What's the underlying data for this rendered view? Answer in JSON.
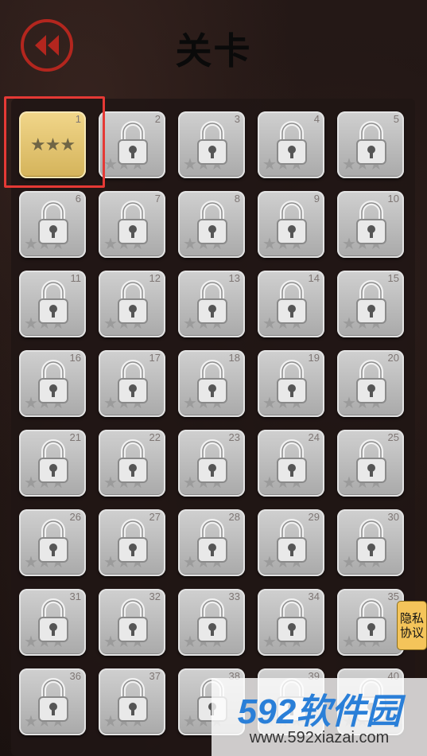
{
  "header": {
    "title": "关卡",
    "back_icon": "rewind-icon",
    "back_color": "#b3261e"
  },
  "levels": [
    {
      "num": "1",
      "locked": false,
      "stars": 3
    },
    {
      "num": "2",
      "locked": true
    },
    {
      "num": "3",
      "locked": true
    },
    {
      "num": "4",
      "locked": true
    },
    {
      "num": "5",
      "locked": true
    },
    {
      "num": "6",
      "locked": true
    },
    {
      "num": "7",
      "locked": true
    },
    {
      "num": "8",
      "locked": true
    },
    {
      "num": "9",
      "locked": true
    },
    {
      "num": "10",
      "locked": true
    },
    {
      "num": "11",
      "locked": true
    },
    {
      "num": "12",
      "locked": true
    },
    {
      "num": "13",
      "locked": true
    },
    {
      "num": "14",
      "locked": true
    },
    {
      "num": "15",
      "locked": true
    },
    {
      "num": "16",
      "locked": true
    },
    {
      "num": "17",
      "locked": true
    },
    {
      "num": "18",
      "locked": true
    },
    {
      "num": "19",
      "locked": true
    },
    {
      "num": "20",
      "locked": true
    },
    {
      "num": "21",
      "locked": true
    },
    {
      "num": "22",
      "locked": true
    },
    {
      "num": "23",
      "locked": true
    },
    {
      "num": "24",
      "locked": true
    },
    {
      "num": "25",
      "locked": true
    },
    {
      "num": "26",
      "locked": true
    },
    {
      "num": "27",
      "locked": true
    },
    {
      "num": "28",
      "locked": true
    },
    {
      "num": "29",
      "locked": true
    },
    {
      "num": "30",
      "locked": true
    },
    {
      "num": "31",
      "locked": true
    },
    {
      "num": "32",
      "locked": true
    },
    {
      "num": "33",
      "locked": true
    },
    {
      "num": "34",
      "locked": true
    },
    {
      "num": "35",
      "locked": true
    },
    {
      "num": "36",
      "locked": true
    },
    {
      "num": "37",
      "locked": true
    },
    {
      "num": "38",
      "locked": true
    },
    {
      "num": "39",
      "locked": true
    },
    {
      "num": "40",
      "locked": true
    }
  ],
  "privacy": {
    "line1": "隐私",
    "line2": "协议"
  },
  "watermark": {
    "logo": "592软件园",
    "url": "www.592xiazai.com"
  },
  "colors": {
    "highlight": "#e53935",
    "unlocked_tile": "#e6c46f",
    "locked_tile": "#bdbdbd"
  }
}
